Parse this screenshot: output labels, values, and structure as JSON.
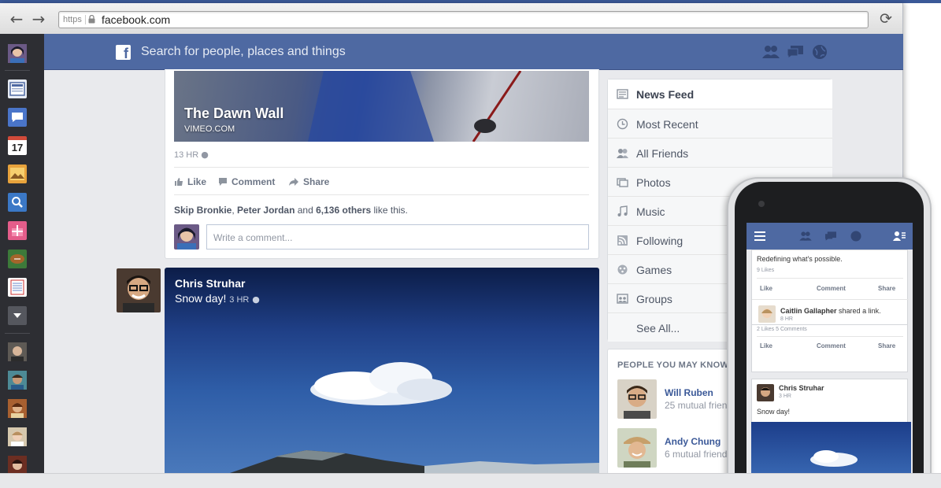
{
  "browser": {
    "url_scheme": "https",
    "url": "facebook.com",
    "back_icon": "back-arrow-icon",
    "forward_icon": "forward-arrow-icon",
    "reload_icon": "reload-icon"
  },
  "sidebar": {
    "calendar_day": "17",
    "icons": [
      "profile-avatar",
      "news-feed-icon",
      "messages-icon",
      "calendar-icon",
      "photos-icon",
      "search-icon",
      "gifts-icon",
      "games-icon",
      "notes-icon",
      "more-icon"
    ],
    "friends": [
      "friend-1",
      "friend-2",
      "friend-3",
      "friend-4",
      "friend-5"
    ]
  },
  "header": {
    "logo": "f",
    "search_placeholder": "Search for people, places and things",
    "icons": [
      "friend-requests-icon",
      "messages-icon",
      "notifications-globe-icon"
    ]
  },
  "feed": {
    "shared_post": {
      "title": "The Dawn Wall",
      "source": "VIMEO.COM",
      "time": "13 HR",
      "actions": {
        "like": "Like",
        "comment": "Comment",
        "share": "Share"
      },
      "likes": {
        "name1": "Skip Bronkie",
        "sep1": ",",
        "name2": "Peter Jordan",
        "and": "and",
        "others": "6,136 others",
        "suffix": "like this."
      },
      "comment_placeholder": "Write a comment..."
    },
    "photo_post": {
      "author": "Chris Struhar",
      "text": "Snow day!",
      "time": "3 HR"
    }
  },
  "right_nav": {
    "items": [
      {
        "label": "News Feed",
        "icon": "news-feed-icon"
      },
      {
        "label": "Most Recent",
        "icon": "clock-icon"
      },
      {
        "label": "All Friends",
        "icon": "friends-icon"
      },
      {
        "label": "Photos",
        "icon": "photos-icon"
      },
      {
        "label": "Music",
        "icon": "music-note-icon"
      },
      {
        "label": "Following",
        "icon": "rss-icon"
      },
      {
        "label": "Games",
        "icon": "games-controller-icon"
      },
      {
        "label": "Groups",
        "icon": "groups-icon"
      },
      {
        "label": "See All...",
        "icon": ""
      }
    ]
  },
  "pymk": {
    "title": "PEOPLE YOU MAY KNOW",
    "people": [
      {
        "name": "Will Ruben",
        "mutual": "25 mutual frien"
      },
      {
        "name": "Andy Chung",
        "mutual": "6 mutual friend"
      }
    ]
  },
  "phone": {
    "post1_text": "Redefining what's possible.",
    "post1_likes": "9 Likes",
    "actions": {
      "like": "Like",
      "comment": "Comment",
      "share": "Share"
    },
    "post2_author": "Caitlin Gallapher",
    "post2_action": "shared a link.",
    "post2_time": "8 HR",
    "post2_stats": "2 Likes  5 Comments",
    "post3_author": "Chris Struhar",
    "post3_time": "3 HR",
    "post3_text": "Snow day!"
  }
}
